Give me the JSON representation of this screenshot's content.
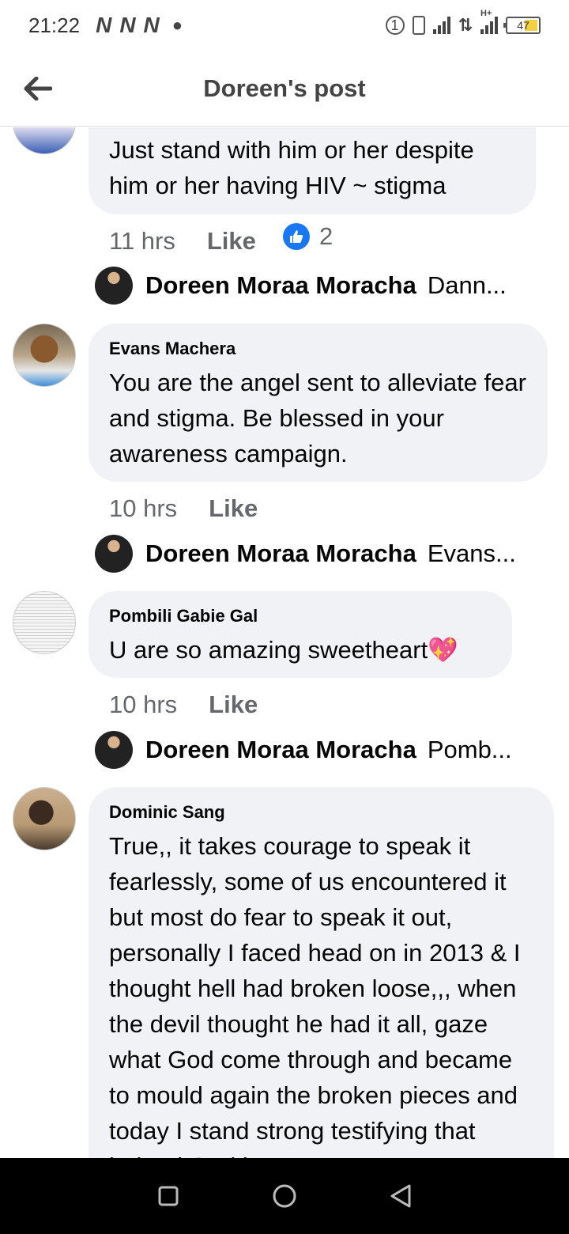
{
  "status_bar": {
    "time": "21:22",
    "battery": "47",
    "network_label": "H+"
  },
  "header": {
    "title": "Doreen's post"
  },
  "comments": [
    {
      "text": "Just stand with him or her despite him or her having HIV ~ stigma",
      "time": "11 hrs",
      "like_label": "Like",
      "reaction_count": "2",
      "reply": {
        "name": "Doreen Moraa Moracha",
        "snippet": "Dann..."
      }
    },
    {
      "author": "Evans Machera",
      "text": "You are the angel sent to alleviate fear and stigma. Be blessed in your awareness campaign.",
      "time": "10 hrs",
      "like_label": "Like",
      "reply": {
        "name": "Doreen Moraa Moracha",
        "snippet": "Evans..."
      }
    },
    {
      "author": "Pombili Gabie Gal",
      "text": "U are so amazing sweetheart💖",
      "time": "10 hrs",
      "like_label": "Like",
      "reply": {
        "name": "Doreen Moraa Moracha",
        "snippet": "Pomb..."
      }
    },
    {
      "author": "Dominic Sang",
      "text": "True,, it takes courage to speak it fearlessly, some of us encountered it but most do fear to speak it out, personally I faced head on in 2013 & I thought hell had broken loose,,, when the devil thought he had it all, gaze what God come through and became to mould again the broken pieces and today I stand strong testifying that indeed God is great"
    }
  ],
  "colors": {
    "bubble": "#f0f2f5",
    "meta_text": "#65676b",
    "like_badge": "#1877f2"
  }
}
